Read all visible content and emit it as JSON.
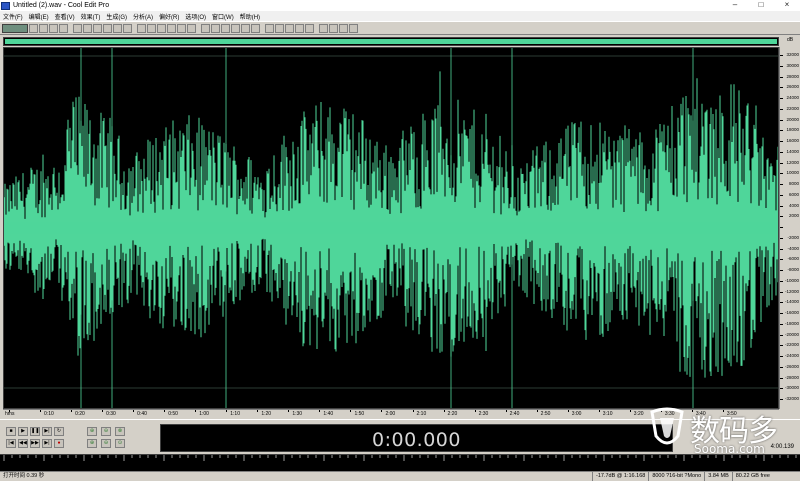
{
  "window": {
    "title": "Untitled (2).wav - Cool Edit Pro",
    "controls": [
      "–",
      "□",
      "×"
    ]
  },
  "menu": [
    {
      "label": "文件(F)"
    },
    {
      "label": "编辑(E)"
    },
    {
      "label": "查看(V)"
    },
    {
      "label": "效果(T)"
    },
    {
      "label": "生成(G)"
    },
    {
      "label": "分析(A)"
    },
    {
      "label": "偏好(R)"
    },
    {
      "label": "选项(O)"
    },
    {
      "label": "窗口(W)"
    },
    {
      "label": "帮助(H)"
    }
  ],
  "toolbar": {
    "icons": [
      "multitrack-icon",
      "new-icon",
      "open-icon",
      "save-icon",
      "close-icon",
      "undo-icon",
      "redo-icon",
      "cut-icon",
      "copy-icon",
      "paste-icon",
      "mix-paste-icon",
      "trim-icon",
      "silence-icon",
      "loop-icon",
      "cue-icon",
      "mark-icon",
      "normalize-icon",
      "amplify-icon",
      "envelope-icon",
      "fade-icon",
      "noise-icon",
      "reverb-icon",
      "echo-icon",
      "eq-icon",
      "pitch-icon",
      "stretch-icon",
      "filter-icon",
      "dither-icon",
      "spectral-icon",
      "analyze-icon",
      "settings-icon",
      "help-icon"
    ]
  },
  "overview": {
    "scale_label": "dB"
  },
  "amplitude_ruler": {
    "labels": [
      "32000",
      "30000",
      "28000",
      "26000",
      "24000",
      "22000",
      "20000",
      "18000",
      "16000",
      "14000",
      "12000",
      "10000",
      "8000",
      "6000",
      "4000",
      "2000",
      "",
      "-2000",
      "-4000",
      "-6000",
      "-8000",
      "-10000",
      "-12000",
      "-14000",
      "-16000",
      "-18000",
      "-20000",
      "-22000",
      "-24000",
      "-26000",
      "-28000",
      "-30000",
      "-32000"
    ]
  },
  "time_ruler": {
    "labels": [
      "hms",
      "0:10",
      "0:20",
      "0:30",
      "0:40",
      "0:50",
      "1:00",
      "1:10",
      "1:20",
      "1:30",
      "1:40",
      "1:50",
      "2:00",
      "2:10",
      "2:20",
      "2:30",
      "2:40",
      "2:50",
      "3:00",
      "3:10",
      "3:20",
      "3:30",
      "3:40",
      "3:50"
    ]
  },
  "transport": {
    "buttons": [
      {
        "name": "stop-button",
        "glyph": "■"
      },
      {
        "name": "play-button",
        "glyph": "▶"
      },
      {
        "name": "pause-button",
        "glyph": "❚❚"
      },
      {
        "name": "play-to-end-button",
        "glyph": "▶|"
      },
      {
        "name": "loop-button",
        "glyph": "↻"
      },
      {
        "name": "go-start-button",
        "glyph": "|◀"
      },
      {
        "name": "rewind-button",
        "glyph": "◀◀"
      },
      {
        "name": "forward-button",
        "glyph": "▶▶"
      },
      {
        "name": "go-end-button",
        "glyph": "▶|"
      },
      {
        "name": "record-button",
        "glyph": "●"
      }
    ],
    "zoom_buttons": [
      {
        "name": "zoom-in-h-button",
        "glyph": "⊕"
      },
      {
        "name": "zoom-out-h-button",
        "glyph": "⊖"
      },
      {
        "name": "zoom-full-button",
        "glyph": "⊗"
      },
      {
        "name": "zoom-in-v-button",
        "glyph": "⊕"
      },
      {
        "name": "zoom-out-v-button",
        "glyph": "⊖"
      },
      {
        "name": "zoom-sel-button",
        "glyph": "⊙"
      }
    ],
    "time": "0:00.000",
    "info_value": "4:00.139"
  },
  "status": {
    "left": "打开时间 0.39 秒",
    "cells": [
      "-17.7dB @ 1:16.168",
      "8000 ?16-bit ?Mono",
      "3.84 MB",
      "80.22 GB free"
    ]
  },
  "watermark": {
    "cn": "数码多",
    "en": "Sooma.com"
  },
  "colors": {
    "waveform": "#4fd69a",
    "background": "#000000",
    "chrome": "#d4d0c8"
  }
}
